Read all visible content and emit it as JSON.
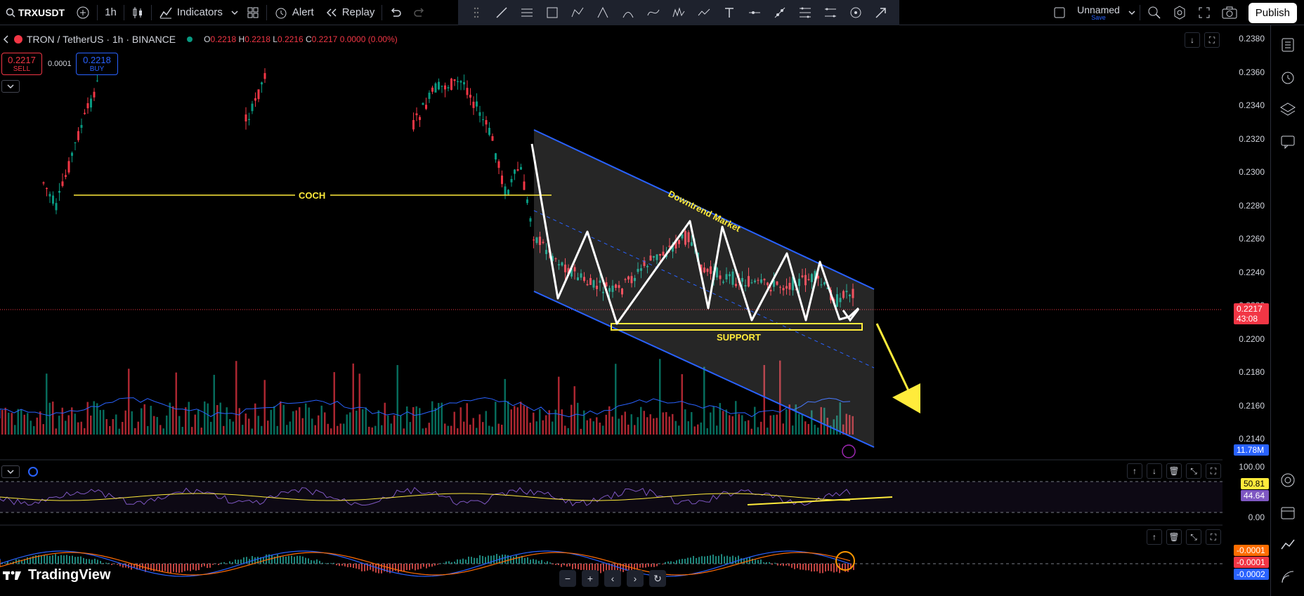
{
  "toolbar": {
    "symbol": "TRXUSDT",
    "interval": "1h",
    "indicators_label": "Indicators",
    "alert_label": "Alert",
    "replay_label": "Replay",
    "layout_name": "Unnamed",
    "layout_status": "Save",
    "publish_label": "Publish"
  },
  "legend": {
    "title": "TRON / TetherUS · 1h · BINANCE",
    "o_label": "O",
    "o": "0.2218",
    "h_label": "H",
    "h": "0.2218",
    "l_label": "L",
    "l": "0.2216",
    "c_label": "C",
    "c": "0.2217",
    "change": "0.0000 (0.00%)"
  },
  "trade": {
    "sell_price": "0.2217",
    "sell_label": "SELL",
    "spread": "0.0001",
    "buy_price": "0.2218",
    "buy_label": "BUY"
  },
  "price_axis": {
    "labels": [
      "0.2380",
      "0.2360",
      "0.2340",
      "0.2320",
      "0.2300",
      "0.2280",
      "0.2260",
      "0.2240",
      "0.2220",
      "0.2200",
      "0.2180",
      "0.2160",
      "0.2140"
    ],
    "current_price": "0.2217",
    "countdown": "43:08",
    "volume": "11.78M"
  },
  "annotations": {
    "coch": "COCH",
    "downtrend": "Downtrend Market",
    "support": "SUPPORT"
  },
  "rsi_pane": {
    "upper": "100.00",
    "lower": "0.00",
    "rsi_value": "50.81",
    "ma_value": "44.64"
  },
  "macd_pane": {
    "v1": "-0.0001",
    "v2": "-0.0001",
    "v3": "-0.0002"
  },
  "brand": {
    "logo_text": "TradingView"
  },
  "colors": {
    "up": "#089981",
    "down": "#f23645",
    "accent": "#2962ff",
    "annotation": "#ffeb3b",
    "channel": "#2962ff"
  }
}
